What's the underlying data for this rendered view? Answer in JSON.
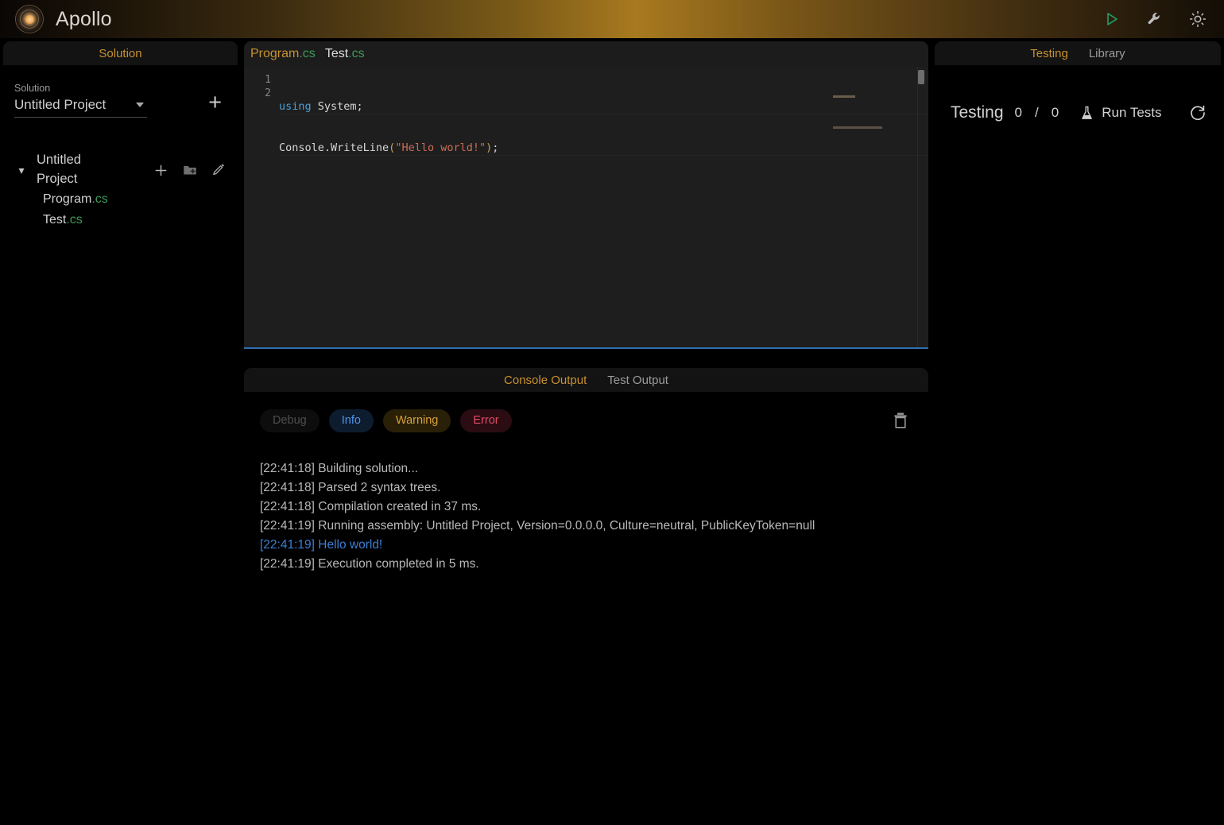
{
  "app": {
    "title": "Apollo",
    "logo_icon": "apollo-sun-medallion",
    "accent": "#c8912f",
    "actions": [
      {
        "name": "run-button",
        "icon": "play-icon",
        "color": "#22a06b"
      },
      {
        "name": "settings-button",
        "icon": "wrench-icon",
        "color": "#b9b9b9"
      },
      {
        "name": "theme-toggle-button",
        "icon": "sun-icon",
        "color": "#b9b9b9"
      }
    ]
  },
  "sidebar": {
    "header_tab": "Solution",
    "solution_label": "Solution",
    "solution_value": "Untitled Project",
    "add_solution_label": "+",
    "tree": {
      "project_name": "Untitled Project",
      "expand_state": "expanded",
      "actions": [
        {
          "name": "add-item-button",
          "icon": "plus-icon"
        },
        {
          "name": "add-folder-button",
          "icon": "folder-plus-icon"
        },
        {
          "name": "rename-project-button",
          "icon": "pencil-icon"
        }
      ],
      "files": [
        {
          "base": "Program",
          "ext": ".cs"
        },
        {
          "base": "Test",
          "ext": ".cs"
        }
      ]
    }
  },
  "editor": {
    "tabs": [
      {
        "base": "Program",
        "ext": ".cs",
        "active": true
      },
      {
        "base": "Test",
        "ext": ".cs",
        "active": false
      }
    ],
    "lines": [
      {
        "number": "1",
        "tokens": [
          {
            "t": "using",
            "c": "kw"
          },
          {
            "t": " System;",
            "c": ""
          }
        ]
      },
      {
        "number": "2",
        "tokens": [
          {
            "t": "Console.WriteLine",
            "c": ""
          },
          {
            "t": "(",
            "c": "pun"
          },
          {
            "t": "\"Hello world!\"",
            "c": "str"
          },
          {
            "t": ")",
            "c": "pun"
          },
          {
            "t": ";",
            "c": ""
          }
        ]
      }
    ],
    "line_numbers": "1\n2",
    "line1_number": "1",
    "line2_number": "2",
    "line1_kw": "using",
    "line1_rest": " System;",
    "line2_call": "Console.WriteLine",
    "line2_open": "(",
    "line2_str": "\"Hello world!\"",
    "line2_close": ")",
    "line2_semi": ";"
  },
  "console": {
    "tabs": [
      {
        "label": "Console Output",
        "active": true
      },
      {
        "label": "Test Output",
        "active": false
      }
    ],
    "tab_console": "Console Output",
    "tab_test": "Test Output",
    "filters": [
      {
        "label": "Debug",
        "state": "inactive"
      },
      {
        "label": "Info",
        "state": "active"
      },
      {
        "label": "Warning",
        "state": "active"
      },
      {
        "label": "Error",
        "state": "active"
      }
    ],
    "filter_debug": "Debug",
    "filter_info": "Info",
    "filter_warning": "Warning",
    "filter_error": "Error",
    "clear_icon": "trash-icon",
    "lines": [
      {
        "text": "[22:41:18] Building solution...",
        "level": "info"
      },
      {
        "text": "[22:41:18] Parsed 2 syntax trees.",
        "level": "info"
      },
      {
        "text": "[22:41:18] Compilation created in 37 ms.",
        "level": "info"
      },
      {
        "text": "[22:41:19] Running assembly: Untitled Project, Version=0.0.0.0, Culture=neutral, PublicKeyToken=null",
        "level": "info"
      },
      {
        "text": "[22:41:19] Hello world!",
        "level": "stdout"
      },
      {
        "text": "[22:41:19] Execution completed in 5 ms.",
        "level": "info"
      }
    ],
    "line_0": "[22:41:18] Building solution...",
    "line_1": "[22:41:18] Parsed 2 syntax trees.",
    "line_2": "[22:41:18] Compilation created in 37 ms.",
    "line_3": "[22:41:19] Running assembly: Untitled Project, Version=0.0.0.0, Culture=neutral, PublicKeyToken=null",
    "line_4": "[22:41:19] Hello world!",
    "line_5": "[22:41:19] Execution completed in 5 ms."
  },
  "right_panel": {
    "tabs": [
      {
        "label": "Testing",
        "active": true
      },
      {
        "label": "Library",
        "active": false
      }
    ],
    "tab_testing": "Testing",
    "tab_library": "Library",
    "heading": "Testing",
    "passed": "0",
    "separator": "/",
    "total": "0",
    "run_tests_label": "Run Tests",
    "run_tests_icon": "flask-icon",
    "refresh_icon": "refresh-icon"
  }
}
